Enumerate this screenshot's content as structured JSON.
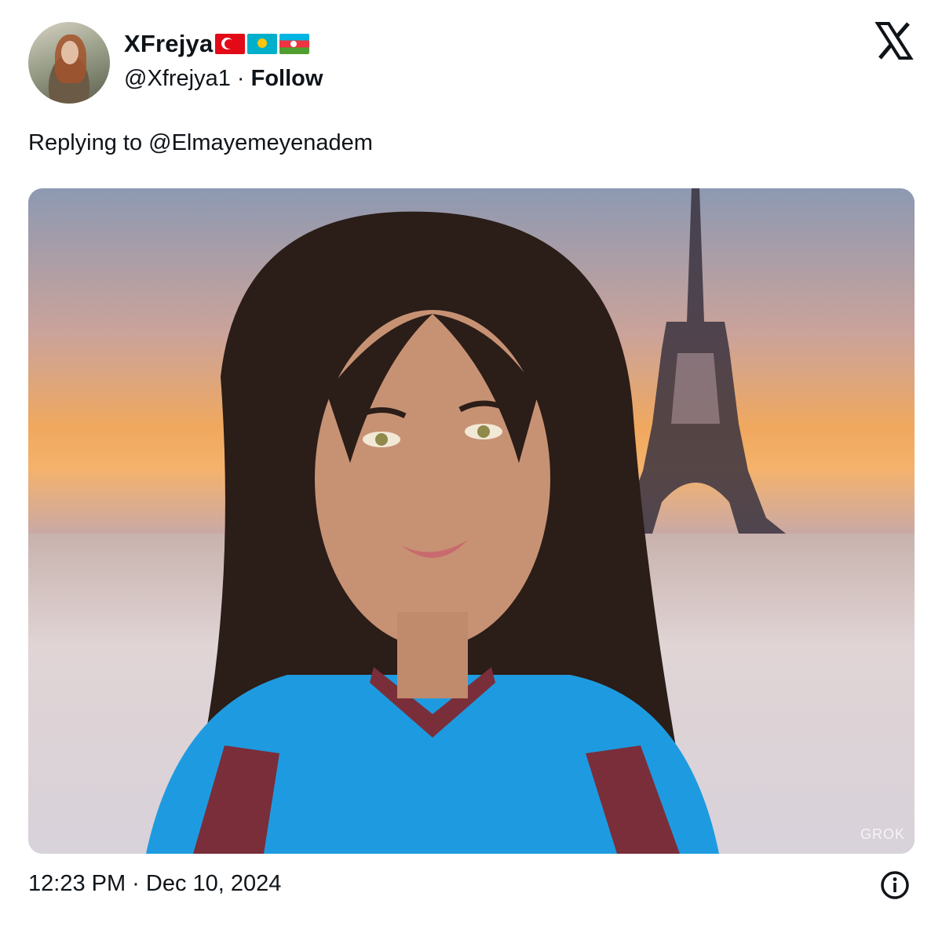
{
  "author": {
    "name": "XFrejya",
    "handle": "@Xfrejya1",
    "separator": "·",
    "follow_label": "Follow",
    "flags": [
      "flag-turkey-icon",
      "flag-kazakhstan-icon",
      "flag-azerbaijan-icon"
    ]
  },
  "reply": {
    "text": "Replying to @Elmayemeyenadem"
  },
  "media": {
    "watermark": "GROK"
  },
  "footer": {
    "timestamp": "12:23 PM · Dec 10, 2024"
  },
  "icons": {
    "logo": "x-logo-icon",
    "info": "info-icon"
  },
  "colors": {
    "text": "#0f1419",
    "background": "#ffffff"
  }
}
